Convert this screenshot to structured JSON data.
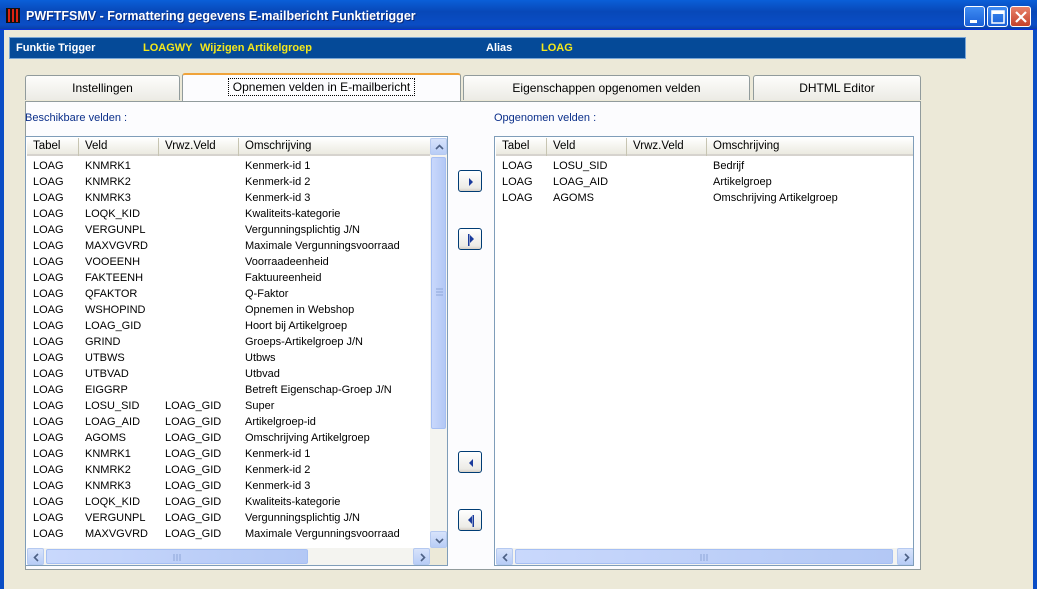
{
  "window": {
    "title": "PWFTFSMV - Formattering gegevens E-mailbericht Funktietrigger",
    "icon": "app-icon",
    "controls": [
      "minimize-icon",
      "maximize-icon",
      "close-icon"
    ]
  },
  "info": {
    "trigger_label": "Funktie Trigger",
    "trigger_code": "LOAGWY",
    "trigger_desc": "Wijzigen Artikelgroep",
    "alias_label": "Alias",
    "alias_value": "LOAG"
  },
  "tabs": [
    {
      "label": "Instellingen",
      "active": false
    },
    {
      "label": "Opnemen velden in E-mailbericht",
      "active": true
    },
    {
      "label": "Eigenschappen opgenomen velden",
      "active": false
    },
    {
      "label": "DHTML Editor",
      "active": false
    }
  ],
  "available": {
    "title": "Beschikbare velden :",
    "columns": [
      "Tabel",
      "Veld",
      "Vrwz.Veld",
      "Omschrijving"
    ],
    "rows": [
      [
        "LOAG",
        "KNMRK1",
        "",
        "Kenmerk-id 1"
      ],
      [
        "LOAG",
        "KNMRK2",
        "",
        "Kenmerk-id 2"
      ],
      [
        "LOAG",
        "KNMRK3",
        "",
        "Kenmerk-id 3"
      ],
      [
        "LOAG",
        "LOQK_KID",
        "",
        "Kwaliteits-kategorie"
      ],
      [
        "LOAG",
        "VERGUNPL",
        "",
        "Vergunningsplichtig J/N"
      ],
      [
        "LOAG",
        "MAXVGVRD",
        "",
        "Maximale Vergunningsvoorraad"
      ],
      [
        "LOAG",
        "VOOEENH",
        "",
        "Voorraadeenheid"
      ],
      [
        "LOAG",
        "FAKTEENH",
        "",
        "Faktuureenheid"
      ],
      [
        "LOAG",
        "QFAKTOR",
        "",
        "Q-Faktor"
      ],
      [
        "LOAG",
        "WSHOPIND",
        "",
        "Opnemen in Webshop"
      ],
      [
        "LOAG",
        "LOAG_GID",
        "",
        "Hoort bij Artikelgroep"
      ],
      [
        "LOAG",
        "GRIND",
        "",
        "Groeps-Artikelgroep J/N"
      ],
      [
        "LOAG",
        "UTBWS",
        "",
        "Utbws"
      ],
      [
        "LOAG",
        "UTBVAD",
        "",
        "Utbvad"
      ],
      [
        "LOAG",
        "EIGGRP",
        "",
        "Betreft Eigenschap-Groep J/N"
      ],
      [
        "LOAG",
        "LOSU_SID",
        "LOAG_GID",
        "Super"
      ],
      [
        "LOAG",
        "LOAG_AID",
        "LOAG_GID",
        "Artikelgroep-id"
      ],
      [
        "LOAG",
        "AGOMS",
        "LOAG_GID",
        "Omschrijving Artikelgroep"
      ],
      [
        "LOAG",
        "KNMRK1",
        "LOAG_GID",
        "Kenmerk-id 1"
      ],
      [
        "LOAG",
        "KNMRK2",
        "LOAG_GID",
        "Kenmerk-id 2"
      ],
      [
        "LOAG",
        "KNMRK3",
        "LOAG_GID",
        "Kenmerk-id 3"
      ],
      [
        "LOAG",
        "LOQK_KID",
        "LOAG_GID",
        "Kwaliteits-kategorie"
      ],
      [
        "LOAG",
        "VERGUNPL",
        "LOAG_GID",
        "Vergunningsplichtig J/N"
      ],
      [
        "LOAG",
        "MAXVGVRD",
        "LOAG_GID",
        "Maximale Vergunningsvoorraad"
      ]
    ]
  },
  "selected": {
    "title": "Opgenomen velden :",
    "columns": [
      "Tabel",
      "Veld",
      "Vrwz.Veld",
      "Omschrijving"
    ],
    "rows": [
      [
        "LOAG",
        "LOSU_SID",
        "",
        "Bedrijf"
      ],
      [
        "LOAG",
        "LOAG_AID",
        "",
        "Artikelgroep"
      ],
      [
        "LOAG",
        "AGOMS",
        "",
        "Omschrijving Artikelgroep"
      ]
    ]
  },
  "move_buttons": [
    {
      "name": "add-selected-button",
      "icon": "arrow-right-icon"
    },
    {
      "name": "add-all-button",
      "icon": "double-arrow-right-icon"
    },
    {
      "name": "remove-selected-button",
      "icon": "arrow-left-icon"
    },
    {
      "name": "remove-all-button",
      "icon": "double-arrow-left-icon"
    }
  ],
  "colors": {
    "titlebar": "#0a4dc5",
    "infobar": "#054a98",
    "info_value": "#f4e81b",
    "section_label": "#0b2f8a",
    "window_bg": "#ece9d8"
  }
}
